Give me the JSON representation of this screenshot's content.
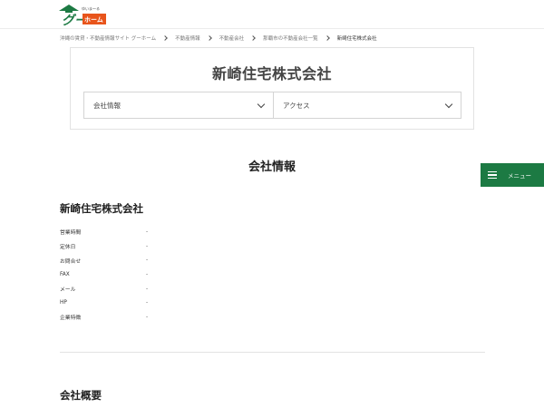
{
  "header": {
    "logo": {
      "tagline": "ゆいま～る",
      "name_part1": "グー",
      "name_part2": "ホーム"
    }
  },
  "breadcrumb": [
    {
      "label": "沖縄の賃貸・不動産情報サイト グーホーム"
    },
    {
      "label": "不動産情報"
    },
    {
      "label": "不動産会社"
    },
    {
      "label": "那覇市の不動産会社一覧"
    },
    {
      "label": "新崎住宅株式会社"
    }
  ],
  "company_header": {
    "title": "新崎住宅株式会社",
    "select_company_info": "会社情報",
    "select_access": "アクセス"
  },
  "section": {
    "heading": "会社情報"
  },
  "menu": {
    "label": "メニュー",
    "color": "#1c7a43"
  },
  "company_info": {
    "name": "新崎住宅株式会社",
    "rows": [
      {
        "label": "営業時間",
        "value": "-"
      },
      {
        "label": "定休日",
        "value": "-"
      },
      {
        "label": "お問合せ",
        "value": "-"
      },
      {
        "label": "FAX",
        "value": "-"
      },
      {
        "label": "メール",
        "value": "-"
      },
      {
        "label": "HP",
        "value": "-"
      },
      {
        "label": "企業特徴",
        "value": "-"
      }
    ]
  },
  "overview": {
    "heading": "会社概要"
  }
}
